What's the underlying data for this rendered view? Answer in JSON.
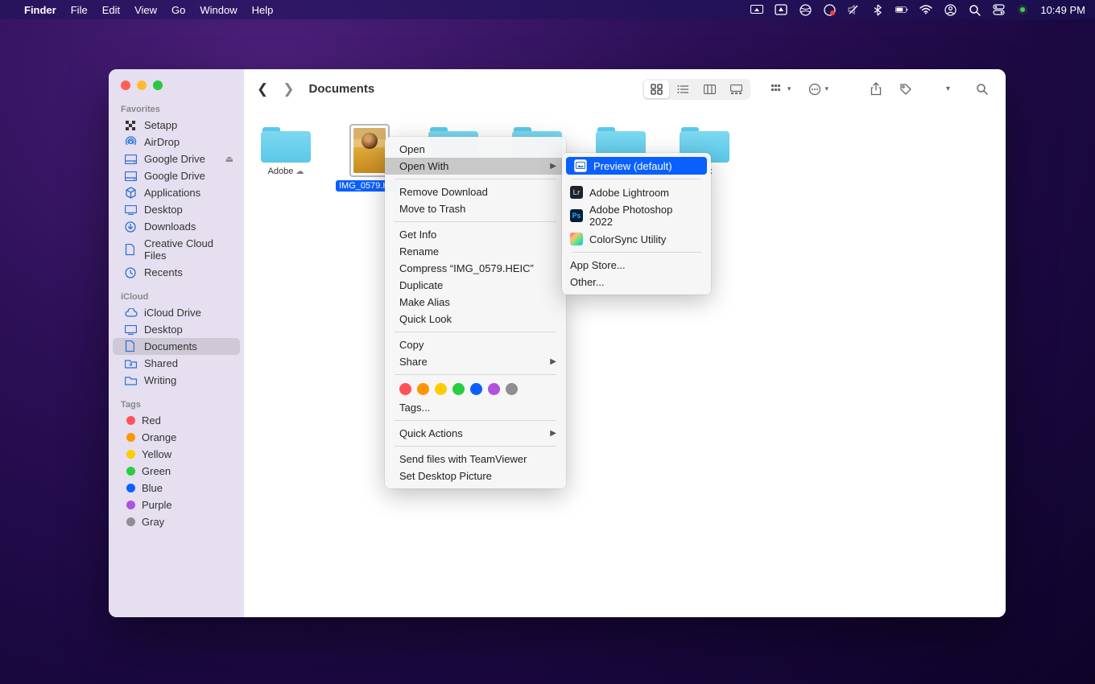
{
  "menubar": {
    "app": "Finder",
    "items": [
      "File",
      "Edit",
      "View",
      "Go",
      "Window",
      "Help"
    ],
    "clock": "10:49 PM"
  },
  "window": {
    "title": "Documents"
  },
  "sidebar": {
    "favorites_hdr": "Favorites",
    "favorites": [
      {
        "label": "Setapp",
        "icon": "grid"
      },
      {
        "label": "AirDrop",
        "icon": "airdrop"
      },
      {
        "label": "Google Drive",
        "icon": "drive",
        "eject": true
      },
      {
        "label": "Google Drive",
        "icon": "drive"
      },
      {
        "label": "Applications",
        "icon": "apps"
      },
      {
        "label": "Desktop",
        "icon": "desktop"
      },
      {
        "label": "Downloads",
        "icon": "downloads"
      },
      {
        "label": "Creative Cloud Files",
        "icon": "doc"
      },
      {
        "label": "Recents",
        "icon": "clock"
      }
    ],
    "icloud_hdr": "iCloud",
    "icloud": [
      {
        "label": "iCloud Drive",
        "icon": "cloud"
      },
      {
        "label": "Desktop",
        "icon": "desktop"
      },
      {
        "label": "Documents",
        "icon": "doc",
        "sel": true
      },
      {
        "label": "Shared",
        "icon": "shared"
      },
      {
        "label": "Writing",
        "icon": "folder"
      }
    ],
    "tags_hdr": "Tags",
    "tags": [
      {
        "label": "Red",
        "c": "#ff5257"
      },
      {
        "label": "Orange",
        "c": "#ff9500"
      },
      {
        "label": "Yellow",
        "c": "#ffcc00"
      },
      {
        "label": "Green",
        "c": "#28cd41"
      },
      {
        "label": "Blue",
        "c": "#0a60ff"
      },
      {
        "label": "Purple",
        "c": "#af52de"
      },
      {
        "label": "Gray",
        "c": "#8e8e93"
      }
    ]
  },
  "files": [
    {
      "name": "Adobe",
      "type": "folder",
      "cloud": true
    },
    {
      "name": "IMG_0579.HEIC",
      "type": "image",
      "sel": true
    },
    {
      "name": "",
      "type": "folder"
    },
    {
      "name": "",
      "type": "folder"
    },
    {
      "name": "",
      "type": "folder"
    },
    {
      "name": "bEx",
      "type": "folder"
    }
  ],
  "ctx": {
    "open": "Open",
    "openwith": "Open With",
    "remove": "Remove Download",
    "trash": "Move to Trash",
    "getinfo": "Get Info",
    "rename": "Rename",
    "compress": "Compress “IMG_0579.HEIC”",
    "duplicate": "Duplicate",
    "alias": "Make Alias",
    "quicklook": "Quick Look",
    "copy": "Copy",
    "share": "Share",
    "tags": "Tags...",
    "quick": "Quick Actions",
    "tv": "Send files with TeamViewer",
    "desktop": "Set Desktop Picture",
    "tagcolors": [
      "#ff5257",
      "#ff9500",
      "#ffcc00",
      "#28cd41",
      "#0a60ff",
      "#af52de",
      "#8e8e93"
    ]
  },
  "ctx2": {
    "preview": "Preview (default)",
    "apps": [
      {
        "label": "Adobe Lightroom",
        "bg": "#222",
        "fg": "#6fb8ff",
        "t": "Lr"
      },
      {
        "label": "Adobe Photoshop 2022",
        "bg": "#001e36",
        "fg": "#31a8ff",
        "t": "Ps"
      },
      {
        "label": "ColorSync Utility",
        "bg": "linear-gradient(135deg,#ff5f6d,#ffc371,#47e891,#3fa9f5)",
        "fg": "#fff",
        "t": ""
      }
    ],
    "appstore": "App Store...",
    "other": "Other..."
  }
}
